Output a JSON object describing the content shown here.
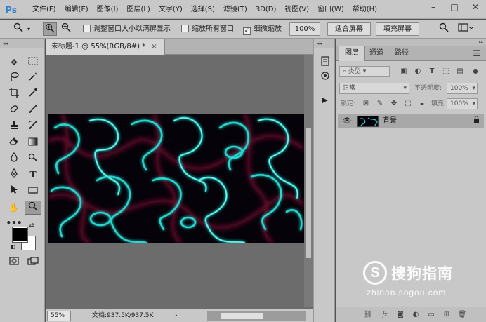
{
  "app": {
    "logo_text": "Ps"
  },
  "menu": [
    "文件(F)",
    "编辑(E)",
    "图像(I)",
    "图层(L)",
    "文字(Y)",
    "选择(S)",
    "滤镜(T)",
    "3D(D)",
    "视图(V)",
    "窗口(W)",
    "帮助(H)"
  ],
  "window_controls": {
    "minimize": "–",
    "maximize": "□",
    "close": "✕"
  },
  "options_bar": {
    "checkbox_resize": {
      "label": "调整窗口大小以满屏显示",
      "checked": false
    },
    "checkbox_zoom_all": {
      "label": "缩放所有窗口",
      "checked": false
    },
    "checkbox_scrubby": {
      "label": "细微缩放",
      "checked": true
    },
    "zoom_value": "100%",
    "fit_screen": "适合屏幕",
    "fill_screen": "填充屏幕"
  },
  "document": {
    "tab_title": "未标题-1 @ 55%(RGB/8#) *",
    "tab_close": "×",
    "status_zoom": "55%",
    "status_info": "文档:937.5K/937.5K"
  },
  "layers_panel": {
    "tabs": [
      "图层",
      "通道",
      "路径"
    ],
    "active_tab": "图层",
    "filter_kind": "类型",
    "blend_mode": "正常",
    "opacity_label": "不透明度:",
    "opacity_value": "100%",
    "lock_label": "锁定:",
    "fill_label": "填充:",
    "fill_value": "100%",
    "layers": [
      {
        "name": "背景",
        "visible": true,
        "locked": true
      }
    ]
  },
  "watermark": {
    "brand": "搜狗指南",
    "badge": "S",
    "url": "zhinan.sogou.com"
  },
  "colors": {
    "ui_gray": "#c8c8c8",
    "canvas_bg": "#6c6c6c",
    "ps_blue": "#2a7fd4",
    "foreground": "#000000",
    "background": "#ffffff"
  },
  "icons": [
    "zoom-in-icon",
    "zoom-out-icon",
    "search-icon",
    "eye-icon",
    "lock-icon",
    "menu-icon"
  ]
}
